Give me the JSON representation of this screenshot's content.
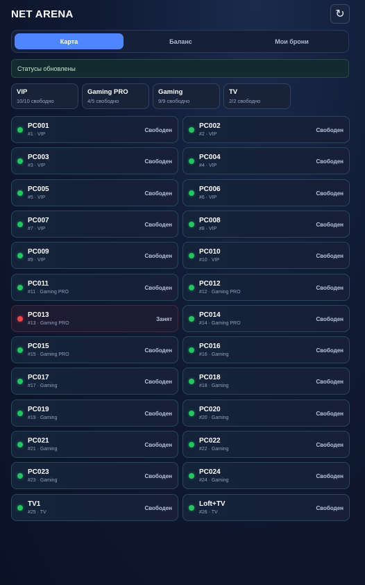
{
  "header": {
    "title": "NET ARENA",
    "refresh_icon": "↻"
  },
  "tabs": [
    {
      "label": "Карта",
      "active": true
    },
    {
      "label": "Баланс",
      "active": false
    },
    {
      "label": "Мои брони",
      "active": false
    }
  ],
  "status_message": "Статусы обновлены",
  "categories": [
    {
      "name": "VIP",
      "availability": "10/10 свободно"
    },
    {
      "name": "Gaming PRO",
      "availability": "4/5 свободно"
    },
    {
      "name": "Gaming",
      "availability": "9/9 свободно"
    },
    {
      "name": "TV",
      "availability": "2/2 свободно"
    }
  ],
  "colors": {
    "accent": "#4f86ff",
    "free": "#22c55e",
    "busy": "#ef4444"
  },
  "pcs": [
    {
      "name": "PC001",
      "sub": "#1 · VIP",
      "status": "Свободен",
      "busy": false
    },
    {
      "name": "PC002",
      "sub": "#2 · VIP",
      "status": "Свободен",
      "busy": false
    },
    {
      "name": "PC003",
      "sub": "#3 · VIP",
      "status": "Свободен",
      "busy": false
    },
    {
      "name": "PC004",
      "sub": "#4 · VIP",
      "status": "Свободен",
      "busy": false
    },
    {
      "name": "PC005",
      "sub": "#5 · VIP",
      "status": "Свободен",
      "busy": false
    },
    {
      "name": "PC006",
      "sub": "#6 · VIP",
      "status": "Свободен",
      "busy": false
    },
    {
      "name": "PC007",
      "sub": "#7 · VIP",
      "status": "Свободен",
      "busy": false
    },
    {
      "name": "PC008",
      "sub": "#8 · VIP",
      "status": "Свободен",
      "busy": false
    },
    {
      "name": "PC009",
      "sub": "#9 · VIP",
      "status": "Свободен",
      "busy": false
    },
    {
      "name": "PC010",
      "sub": "#10 · VIP",
      "status": "Свободен",
      "busy": false
    },
    {
      "name": "PC011",
      "sub": "#11 · Gaming PRO",
      "status": "Свободен",
      "busy": false
    },
    {
      "name": "PC012",
      "sub": "#12 · Gaming PRO",
      "status": "Свободен",
      "busy": false
    },
    {
      "name": "PC013",
      "sub": "#13 · Gaming PRO",
      "status": "Занят",
      "busy": true
    },
    {
      "name": "PC014",
      "sub": "#14 · Gaming PRO",
      "status": "Свободен",
      "busy": false
    },
    {
      "name": "PC015",
      "sub": "#15 · Gaming PRO",
      "status": "Свободен",
      "busy": false
    },
    {
      "name": "PC016",
      "sub": "#16 · Gaming",
      "status": "Свободен",
      "busy": false
    },
    {
      "name": "PC017",
      "sub": "#17 · Gaming",
      "status": "Свободен",
      "busy": false
    },
    {
      "name": "PC018",
      "sub": "#18 · Gaming",
      "status": "Свободен",
      "busy": false
    },
    {
      "name": "PC019",
      "sub": "#19 · Gaming",
      "status": "Свободен",
      "busy": false
    },
    {
      "name": "PC020",
      "sub": "#20 · Gaming",
      "status": "Свободен",
      "busy": false
    },
    {
      "name": "PC021",
      "sub": "#21 · Gaming",
      "status": "Свободен",
      "busy": false
    },
    {
      "name": "PC022",
      "sub": "#22 · Gaming",
      "status": "Свободен",
      "busy": false
    },
    {
      "name": "PC023",
      "sub": "#23 · Gaming",
      "status": "Свободен",
      "busy": false
    },
    {
      "name": "PC024",
      "sub": "#24 · Gaming",
      "status": "Свободен",
      "busy": false
    },
    {
      "name": "TV1",
      "sub": "#25 · TV",
      "status": "Свободен",
      "busy": false
    },
    {
      "name": "Loft+TV",
      "sub": "#26 · TV",
      "status": "Свободен",
      "busy": false
    }
  ]
}
